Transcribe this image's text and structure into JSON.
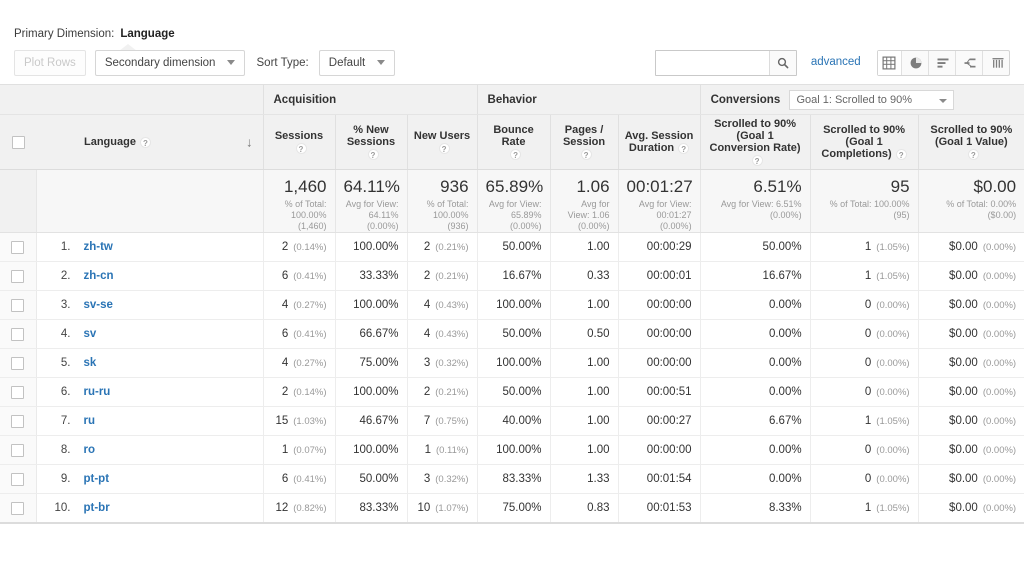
{
  "primary_dimension": {
    "label": "Primary Dimension:",
    "value": "Language"
  },
  "toolbar": {
    "plot_rows_label": "Plot Rows",
    "secondary_dimension_label": "Secondary dimension",
    "sort_type_label": "Sort Type:",
    "sort_type_value": "Default",
    "search_value": "",
    "search_placeholder": "",
    "advanced_label": "advanced",
    "view_icons": [
      {
        "name": "table-view-icon",
        "active": true
      },
      {
        "name": "pie-chart-view-icon",
        "active": false
      },
      {
        "name": "performance-view-icon",
        "active": false
      },
      {
        "name": "comparison-view-icon",
        "active": false
      },
      {
        "name": "pivot-view-icon",
        "active": false
      }
    ]
  },
  "table": {
    "groups": {
      "acquisition": "Acquisition",
      "behavior": "Behavior",
      "conversions": "Conversions",
      "goal_select": "Goal 1: Scrolled to 90%"
    },
    "columns": {
      "dimension": "Language",
      "sessions": "Sessions",
      "new_sessions": "% New Sessions",
      "new_users": "New Users",
      "bounce_rate": "Bounce Rate",
      "pages_session": "Pages / Session",
      "avg_duration": "Avg. Session Duration",
      "goal_rate": "Scrolled to 90% (Goal 1 Conversion Rate)",
      "goal_completions": "Scrolled to 90% (Goal 1 Completions)",
      "goal_value": "Scrolled to 90% (Goal 1 Value)"
    },
    "summary": {
      "sessions": {
        "big": "1,460",
        "sub": "% of Total: 100.00% (1,460)"
      },
      "new_sessions": {
        "big": "64.11%",
        "sub": "Avg for View: 64.11% (0.00%)"
      },
      "new_users": {
        "big": "936",
        "sub": "% of Total: 100.00% (936)"
      },
      "bounce_rate": {
        "big": "65.89%",
        "sub": "Avg for View: 65.89% (0.00%)"
      },
      "pages_session": {
        "big": "1.06",
        "sub": "Avg for View: 1.06 (0.00%)"
      },
      "avg_duration": {
        "big": "00:01:27",
        "sub": "Avg for View: 00:01:27 (0.00%)"
      },
      "goal_rate": {
        "big": "6.51%",
        "sub": "Avg for View: 6.51% (0.00%)"
      },
      "goal_completions": {
        "big": "95",
        "sub": "% of Total: 100.00% (95)"
      },
      "goal_value": {
        "big": "$0.00",
        "sub": "% of Total: 0.00% ($0.00)"
      }
    },
    "rows": [
      {
        "index": "1.",
        "language": "zh-tw",
        "sessions": "2",
        "sessions_pct": "(0.14%)",
        "new_sessions": "100.00%",
        "new_users": "2",
        "new_users_pct": "(0.21%)",
        "bounce_rate": "50.00%",
        "pages_session": "1.00",
        "avg_duration": "00:00:29",
        "goal_rate": "50.00%",
        "goal_completions": "1",
        "goal_completions_pct": "(1.05%)",
        "goal_value": "$0.00",
        "goal_value_pct": "(0.00%)"
      },
      {
        "index": "2.",
        "language": "zh-cn",
        "sessions": "6",
        "sessions_pct": "(0.41%)",
        "new_sessions": "33.33%",
        "new_users": "2",
        "new_users_pct": "(0.21%)",
        "bounce_rate": "16.67%",
        "pages_session": "0.33",
        "avg_duration": "00:00:01",
        "goal_rate": "16.67%",
        "goal_completions": "1",
        "goal_completions_pct": "(1.05%)",
        "goal_value": "$0.00",
        "goal_value_pct": "(0.00%)"
      },
      {
        "index": "3.",
        "language": "sv-se",
        "sessions": "4",
        "sessions_pct": "(0.27%)",
        "new_sessions": "100.00%",
        "new_users": "4",
        "new_users_pct": "(0.43%)",
        "bounce_rate": "100.00%",
        "pages_session": "1.00",
        "avg_duration": "00:00:00",
        "goal_rate": "0.00%",
        "goal_completions": "0",
        "goal_completions_pct": "(0.00%)",
        "goal_value": "$0.00",
        "goal_value_pct": "(0.00%)"
      },
      {
        "index": "4.",
        "language": "sv",
        "sessions": "6",
        "sessions_pct": "(0.41%)",
        "new_sessions": "66.67%",
        "new_users": "4",
        "new_users_pct": "(0.43%)",
        "bounce_rate": "50.00%",
        "pages_session": "0.50",
        "avg_duration": "00:00:00",
        "goal_rate": "0.00%",
        "goal_completions": "0",
        "goal_completions_pct": "(0.00%)",
        "goal_value": "$0.00",
        "goal_value_pct": "(0.00%)"
      },
      {
        "index": "5.",
        "language": "sk",
        "sessions": "4",
        "sessions_pct": "(0.27%)",
        "new_sessions": "75.00%",
        "new_users": "3",
        "new_users_pct": "(0.32%)",
        "bounce_rate": "100.00%",
        "pages_session": "1.00",
        "avg_duration": "00:00:00",
        "goal_rate": "0.00%",
        "goal_completions": "0",
        "goal_completions_pct": "(0.00%)",
        "goal_value": "$0.00",
        "goal_value_pct": "(0.00%)"
      },
      {
        "index": "6.",
        "language": "ru-ru",
        "sessions": "2",
        "sessions_pct": "(0.14%)",
        "new_sessions": "100.00%",
        "new_users": "2",
        "new_users_pct": "(0.21%)",
        "bounce_rate": "50.00%",
        "pages_session": "1.00",
        "avg_duration": "00:00:51",
        "goal_rate": "0.00%",
        "goal_completions": "0",
        "goal_completions_pct": "(0.00%)",
        "goal_value": "$0.00",
        "goal_value_pct": "(0.00%)"
      },
      {
        "index": "7.",
        "language": "ru",
        "sessions": "15",
        "sessions_pct": "(1.03%)",
        "new_sessions": "46.67%",
        "new_users": "7",
        "new_users_pct": "(0.75%)",
        "bounce_rate": "40.00%",
        "pages_session": "1.00",
        "avg_duration": "00:00:27",
        "goal_rate": "6.67%",
        "goal_completions": "1",
        "goal_completions_pct": "(1.05%)",
        "goal_value": "$0.00",
        "goal_value_pct": "(0.00%)"
      },
      {
        "index": "8.",
        "language": "ro",
        "sessions": "1",
        "sessions_pct": "(0.07%)",
        "new_sessions": "100.00%",
        "new_users": "1",
        "new_users_pct": "(0.11%)",
        "bounce_rate": "100.00%",
        "pages_session": "1.00",
        "avg_duration": "00:00:00",
        "goal_rate": "0.00%",
        "goal_completions": "0",
        "goal_completions_pct": "(0.00%)",
        "goal_value": "$0.00",
        "goal_value_pct": "(0.00%)"
      },
      {
        "index": "9.",
        "language": "pt-pt",
        "sessions": "6",
        "sessions_pct": "(0.41%)",
        "new_sessions": "50.00%",
        "new_users": "3",
        "new_users_pct": "(0.32%)",
        "bounce_rate": "83.33%",
        "pages_session": "1.33",
        "avg_duration": "00:01:54",
        "goal_rate": "0.00%",
        "goal_completions": "0",
        "goal_completions_pct": "(0.00%)",
        "goal_value": "$0.00",
        "goal_value_pct": "(0.00%)"
      },
      {
        "index": "10.",
        "language": "pt-br",
        "sessions": "12",
        "sessions_pct": "(0.82%)",
        "new_sessions": "83.33%",
        "new_users": "10",
        "new_users_pct": "(1.07%)",
        "bounce_rate": "75.00%",
        "pages_session": "0.83",
        "avg_duration": "00:01:53",
        "goal_rate": "8.33%",
        "goal_completions": "1",
        "goal_completions_pct": "(1.05%)",
        "goal_value": "$0.00",
        "goal_value_pct": "(0.00%)"
      }
    ]
  },
  "colors": {
    "link": "#2a74b5",
    "header_bg": "#f1f1f1",
    "summary_bg": "#f7f7f7"
  }
}
